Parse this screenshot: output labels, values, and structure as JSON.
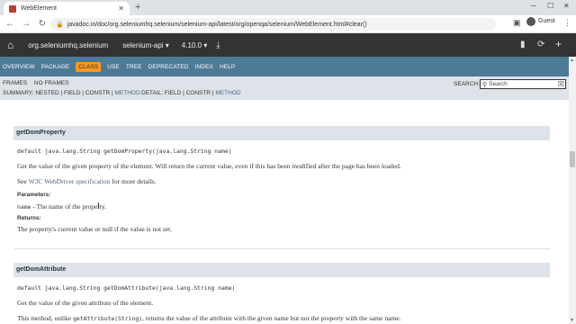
{
  "browser": {
    "tab_title": "WebElement",
    "url": "javadoc.io/doc/org.seleniumhq.selenium/selenium-api/latest/org/openqa/selenium/WebElement.html#clear()",
    "profile_label": "Guest"
  },
  "jdheader": {
    "group": "org.seleniumhq.selenium",
    "artifact": "selenium-api",
    "version": "4.10.0"
  },
  "navbar": {
    "items": [
      "OVERVIEW",
      "PACKAGE",
      "CLASS",
      "USE",
      "TREE",
      "DEPRECATED",
      "INDEX",
      "HELP"
    ],
    "active": "CLASS"
  },
  "subnav": {
    "frames": "FRAMES",
    "no_frames": "NO FRAMES",
    "summary_prefix": "SUMMARY: NESTED | FIELD | CONSTR | ",
    "summary_method": "METHOD",
    "detail_prefix": "DETAIL: FIELD | CONSTR | ",
    "detail_method": "METHOD",
    "search_label": "SEARCH:",
    "search_placeholder": "Search"
  },
  "method1": {
    "name": "getDomProperty",
    "signature": "default java.lang.String getDomProperty(java.lang.String name)",
    "description": "Get the value of the given property of the element. Will return the current value, even if this has been modified after the page has been loaded.",
    "see_prefix": "See ",
    "see_link": "W3C WebDriver specification",
    "see_suffix": " for more details.",
    "params_label": "Parameters:",
    "param_name": "name",
    "param_desc": " - The name of the property.",
    "returns_label": "Returns:",
    "returns_desc": "The property's current value or null if the value is not set."
  },
  "method2": {
    "name": "getDomAttribute",
    "signature": "default java.lang.String getDomAttribute(java.lang.String name)",
    "description": "Get the value of the given attribute of the element.",
    "desc2_prefix": "This method, unlike ",
    "desc2_code": "getAttribute(String)",
    "desc2_suffix": ", returns the value of the attribute with the given name but not the property with the same name."
  }
}
